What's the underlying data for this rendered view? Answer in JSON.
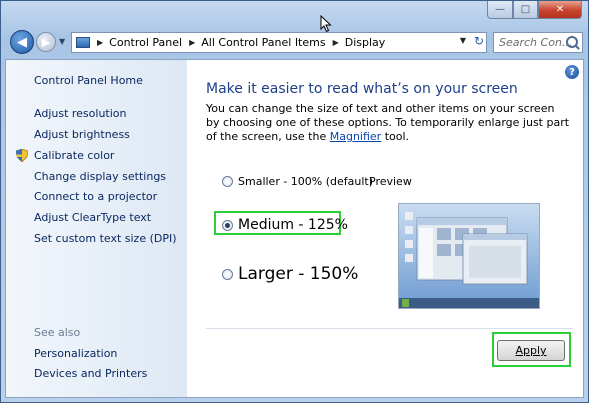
{
  "window": {
    "minimize_glyph": "—",
    "maximize_glyph": "□",
    "close_glyph": "✕"
  },
  "address_bar": {
    "breadcrumbs": [
      "Control Panel",
      "All Control Panel Items",
      "Display"
    ],
    "separator": "▶",
    "search_placeholder": "Search Con..."
  },
  "sidebar": {
    "home": "Control Panel Home",
    "items": [
      "Adjust resolution",
      "Adjust brightness",
      "Calibrate color",
      "Change display settings",
      "Connect to a projector",
      "Adjust ClearType text",
      "Set custom text size (DPI)"
    ],
    "see_also_label": "See also",
    "see_also_items": [
      "Personalization",
      "Devices and Printers"
    ]
  },
  "main": {
    "heading": "Make it easier to read what’s on your screen",
    "description_prefix": "You can change the size of text and other items on your screen by choosing one of these options. To temporarily enlarge just part of the screen, use the ",
    "description_link": "Magnifier",
    "description_suffix": " tool.",
    "options": [
      {
        "label": "Smaller - 100% (default)",
        "selected": false
      },
      {
        "label": "Medium - 125%",
        "selected": true
      },
      {
        "label": "Larger - 150%",
        "selected": false
      }
    ],
    "preview_label": "Preview",
    "apply_label": "Apply"
  },
  "colors": {
    "highlight": "#2ccf35",
    "link": "#0645ad",
    "heading": "#1e3f87"
  }
}
